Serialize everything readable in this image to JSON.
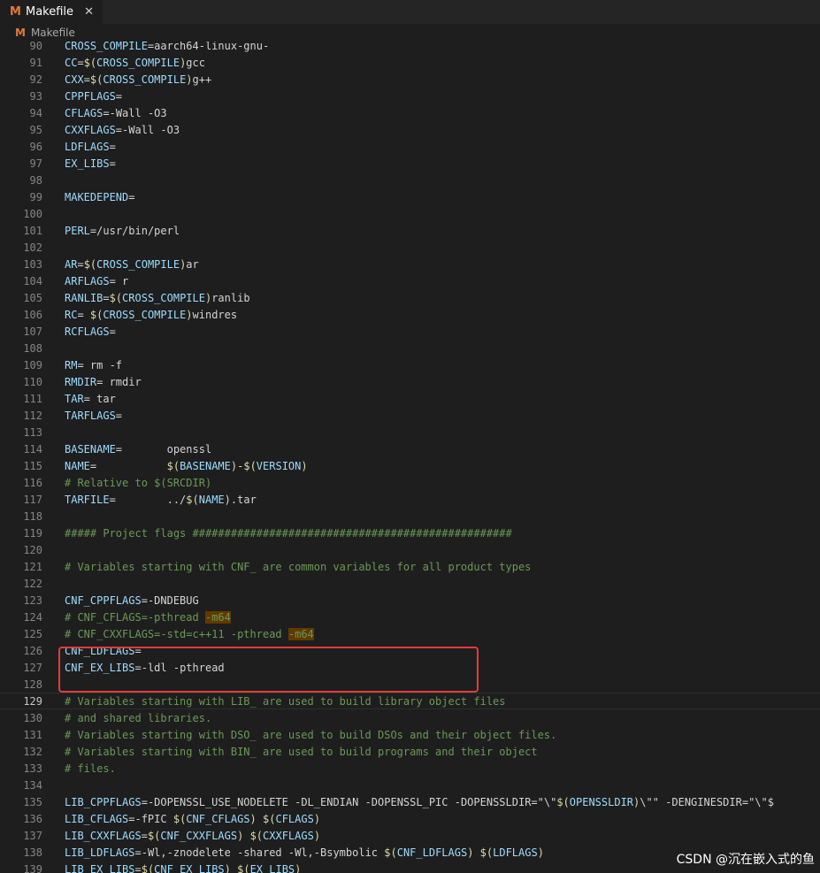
{
  "tab": {
    "icon": "M",
    "title": "Makefile",
    "close": "✕"
  },
  "breadcrumb": {
    "icon": "M",
    "label": "Makefile"
  },
  "active_line": "129",
  "watermark": "CSDN @沉在嵌入式的鱼",
  "lines": [
    {
      "n": "90",
      "t": "CROSS_COMPILE=aarch64-linux-gnu-"
    },
    {
      "n": "91",
      "t": "CC=$(CROSS_COMPILE)gcc"
    },
    {
      "n": "92",
      "t": "CXX=$(CROSS_COMPILE)g++"
    },
    {
      "n": "93",
      "t": "CPPFLAGS="
    },
    {
      "n": "94",
      "t": "CFLAGS=-Wall -O3"
    },
    {
      "n": "95",
      "t": "CXXFLAGS=-Wall -O3"
    },
    {
      "n": "96",
      "t": "LDFLAGS="
    },
    {
      "n": "97",
      "t": "EX_LIBS="
    },
    {
      "n": "98",
      "t": ""
    },
    {
      "n": "99",
      "t": "MAKEDEPEND="
    },
    {
      "n": "100",
      "t": ""
    },
    {
      "n": "101",
      "t": "PERL=/usr/bin/perl"
    },
    {
      "n": "102",
      "t": ""
    },
    {
      "n": "103",
      "t": "AR=$(CROSS_COMPILE)ar"
    },
    {
      "n": "104",
      "t": "ARFLAGS= r"
    },
    {
      "n": "105",
      "t": "RANLIB=$(CROSS_COMPILE)ranlib"
    },
    {
      "n": "106",
      "t": "RC= $(CROSS_COMPILE)windres"
    },
    {
      "n": "107",
      "t": "RCFLAGS="
    },
    {
      "n": "108",
      "t": ""
    },
    {
      "n": "109",
      "t": "RM= rm -f"
    },
    {
      "n": "110",
      "t": "RMDIR= rmdir"
    },
    {
      "n": "111",
      "t": "TAR= tar"
    },
    {
      "n": "112",
      "t": "TARFLAGS="
    },
    {
      "n": "113",
      "t": ""
    },
    {
      "n": "114",
      "t": "BASENAME=       openssl"
    },
    {
      "n": "115",
      "t": "NAME=           $(BASENAME)-$(VERSION)"
    },
    {
      "n": "116",
      "t": "# Relative to $(SRCDIR)"
    },
    {
      "n": "117",
      "t": "TARFILE=        ../$(NAME).tar"
    },
    {
      "n": "118",
      "t": ""
    },
    {
      "n": "119",
      "t": "##### Project flags ##################################################"
    },
    {
      "n": "120",
      "t": ""
    },
    {
      "n": "121",
      "t": "# Variables starting with CNF_ are common variables for all product types"
    },
    {
      "n": "122",
      "t": ""
    },
    {
      "n": "123",
      "t": "CNF_CPPFLAGS=-DNDEBUG"
    },
    {
      "n": "124",
      "t": "# CNF_CFLAGS=-pthread -m64"
    },
    {
      "n": "125",
      "t": "# CNF_CXXFLAGS=-std=c++11 -pthread -m64"
    },
    {
      "n": "126",
      "t": "CNF_LDFLAGS="
    },
    {
      "n": "127",
      "t": "CNF_EX_LIBS=-ldl -pthread"
    },
    {
      "n": "128",
      "t": ""
    },
    {
      "n": "129",
      "t": "# Variables starting with LIB_ are used to build library object files"
    },
    {
      "n": "130",
      "t": "# and shared libraries."
    },
    {
      "n": "131",
      "t": "# Variables starting with DSO_ are used to build DSOs and their object files."
    },
    {
      "n": "132",
      "t": "# Variables starting with BIN_ are used to build programs and their object"
    },
    {
      "n": "133",
      "t": "# files."
    },
    {
      "n": "134",
      "t": ""
    },
    {
      "n": "135",
      "t": "LIB_CPPFLAGS=-DOPENSSL_USE_NODELETE -DL_ENDIAN -DOPENSSL_PIC -DOPENSSLDIR=\"\\\"$(OPENSSLDIR)\\\"\" -DENGINESDIR=\"\\\"$"
    },
    {
      "n": "136",
      "t": "LIB_CFLAGS=-fPIC $(CNF_CFLAGS) $(CFLAGS)"
    },
    {
      "n": "137",
      "t": "LIB_CXXFLAGS=$(CNF_CXXFLAGS) $(CXXFLAGS)"
    },
    {
      "n": "138",
      "t": "LIB_LDFLAGS=-Wl,-znodelete -shared -Wl,-Bsymbolic $(CNF_LDFLAGS) $(LDFLAGS)"
    },
    {
      "n": "139",
      "t": "LIB_EX_LIBS=$(CNF_EX_LIBS) $(EX_LIBS)"
    }
  ]
}
